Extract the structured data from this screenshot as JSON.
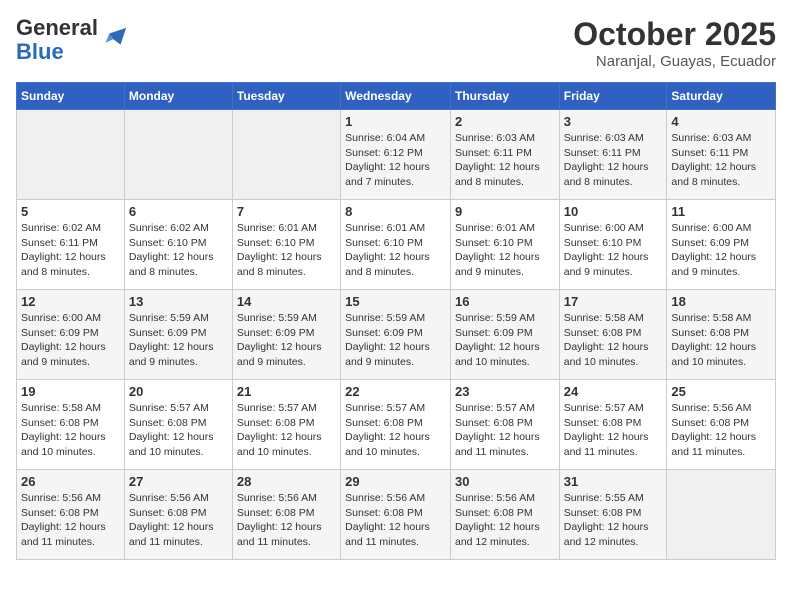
{
  "header": {
    "logo_general": "General",
    "logo_blue": "Blue",
    "month": "October 2025",
    "location": "Naranjal, Guayas, Ecuador"
  },
  "weekdays": [
    "Sunday",
    "Monday",
    "Tuesday",
    "Wednesday",
    "Thursday",
    "Friday",
    "Saturday"
  ],
  "weeks": [
    [
      {
        "day": "",
        "info": ""
      },
      {
        "day": "",
        "info": ""
      },
      {
        "day": "",
        "info": ""
      },
      {
        "day": "1",
        "info": "Sunrise: 6:04 AM\nSunset: 6:12 PM\nDaylight: 12 hours\nand 7 minutes."
      },
      {
        "day": "2",
        "info": "Sunrise: 6:03 AM\nSunset: 6:11 PM\nDaylight: 12 hours\nand 8 minutes."
      },
      {
        "day": "3",
        "info": "Sunrise: 6:03 AM\nSunset: 6:11 PM\nDaylight: 12 hours\nand 8 minutes."
      },
      {
        "day": "4",
        "info": "Sunrise: 6:03 AM\nSunset: 6:11 PM\nDaylight: 12 hours\nand 8 minutes."
      }
    ],
    [
      {
        "day": "5",
        "info": "Sunrise: 6:02 AM\nSunset: 6:11 PM\nDaylight: 12 hours\nand 8 minutes."
      },
      {
        "day": "6",
        "info": "Sunrise: 6:02 AM\nSunset: 6:10 PM\nDaylight: 12 hours\nand 8 minutes."
      },
      {
        "day": "7",
        "info": "Sunrise: 6:01 AM\nSunset: 6:10 PM\nDaylight: 12 hours\nand 8 minutes."
      },
      {
        "day": "8",
        "info": "Sunrise: 6:01 AM\nSunset: 6:10 PM\nDaylight: 12 hours\nand 8 minutes."
      },
      {
        "day": "9",
        "info": "Sunrise: 6:01 AM\nSunset: 6:10 PM\nDaylight: 12 hours\nand 9 minutes."
      },
      {
        "day": "10",
        "info": "Sunrise: 6:00 AM\nSunset: 6:10 PM\nDaylight: 12 hours\nand 9 minutes."
      },
      {
        "day": "11",
        "info": "Sunrise: 6:00 AM\nSunset: 6:09 PM\nDaylight: 12 hours\nand 9 minutes."
      }
    ],
    [
      {
        "day": "12",
        "info": "Sunrise: 6:00 AM\nSunset: 6:09 PM\nDaylight: 12 hours\nand 9 minutes."
      },
      {
        "day": "13",
        "info": "Sunrise: 5:59 AM\nSunset: 6:09 PM\nDaylight: 12 hours\nand 9 minutes."
      },
      {
        "day": "14",
        "info": "Sunrise: 5:59 AM\nSunset: 6:09 PM\nDaylight: 12 hours\nand 9 minutes."
      },
      {
        "day": "15",
        "info": "Sunrise: 5:59 AM\nSunset: 6:09 PM\nDaylight: 12 hours\nand 9 minutes."
      },
      {
        "day": "16",
        "info": "Sunrise: 5:59 AM\nSunset: 6:09 PM\nDaylight: 12 hours\nand 10 minutes."
      },
      {
        "day": "17",
        "info": "Sunrise: 5:58 AM\nSunset: 6:08 PM\nDaylight: 12 hours\nand 10 minutes."
      },
      {
        "day": "18",
        "info": "Sunrise: 5:58 AM\nSunset: 6:08 PM\nDaylight: 12 hours\nand 10 minutes."
      }
    ],
    [
      {
        "day": "19",
        "info": "Sunrise: 5:58 AM\nSunset: 6:08 PM\nDaylight: 12 hours\nand 10 minutes."
      },
      {
        "day": "20",
        "info": "Sunrise: 5:57 AM\nSunset: 6:08 PM\nDaylight: 12 hours\nand 10 minutes."
      },
      {
        "day": "21",
        "info": "Sunrise: 5:57 AM\nSunset: 6:08 PM\nDaylight: 12 hours\nand 10 minutes."
      },
      {
        "day": "22",
        "info": "Sunrise: 5:57 AM\nSunset: 6:08 PM\nDaylight: 12 hours\nand 10 minutes."
      },
      {
        "day": "23",
        "info": "Sunrise: 5:57 AM\nSunset: 6:08 PM\nDaylight: 12 hours\nand 11 minutes."
      },
      {
        "day": "24",
        "info": "Sunrise: 5:57 AM\nSunset: 6:08 PM\nDaylight: 12 hours\nand 11 minutes."
      },
      {
        "day": "25",
        "info": "Sunrise: 5:56 AM\nSunset: 6:08 PM\nDaylight: 12 hours\nand 11 minutes."
      }
    ],
    [
      {
        "day": "26",
        "info": "Sunrise: 5:56 AM\nSunset: 6:08 PM\nDaylight: 12 hours\nand 11 minutes."
      },
      {
        "day": "27",
        "info": "Sunrise: 5:56 AM\nSunset: 6:08 PM\nDaylight: 12 hours\nand 11 minutes."
      },
      {
        "day": "28",
        "info": "Sunrise: 5:56 AM\nSunset: 6:08 PM\nDaylight: 12 hours\nand 11 minutes."
      },
      {
        "day": "29",
        "info": "Sunrise: 5:56 AM\nSunset: 6:08 PM\nDaylight: 12 hours\nand 11 minutes."
      },
      {
        "day": "30",
        "info": "Sunrise: 5:56 AM\nSunset: 6:08 PM\nDaylight: 12 hours\nand 12 minutes."
      },
      {
        "day": "31",
        "info": "Sunrise: 5:55 AM\nSunset: 6:08 PM\nDaylight: 12 hours\nand 12 minutes."
      },
      {
        "day": "",
        "info": ""
      }
    ]
  ]
}
